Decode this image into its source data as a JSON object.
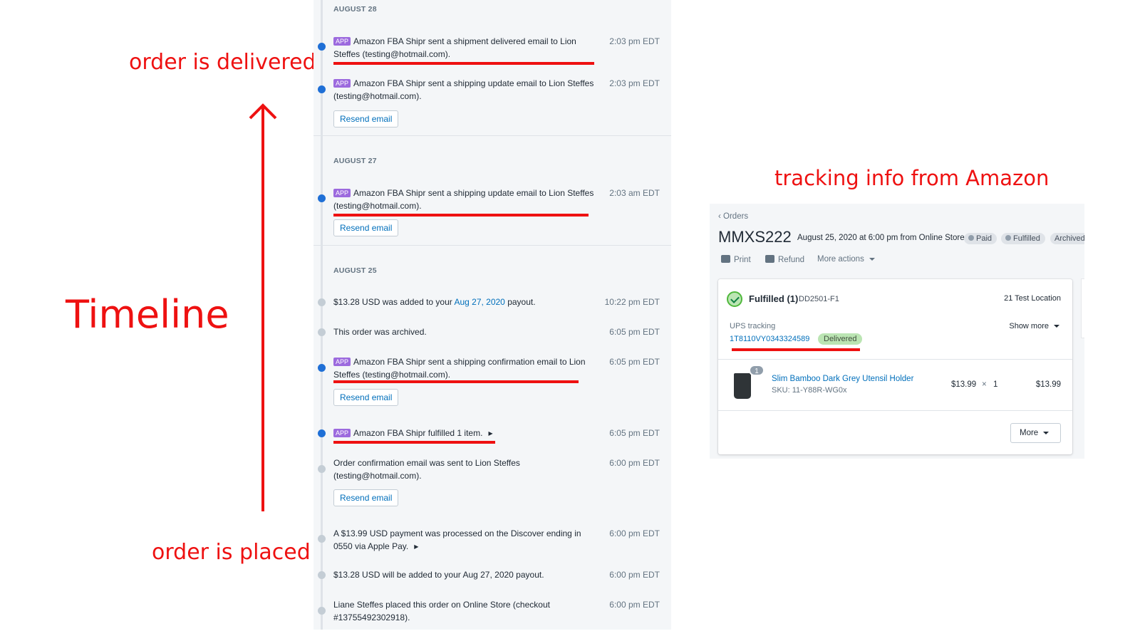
{
  "annotations": {
    "delivered": "order is delivered",
    "placed": "order is placed",
    "timeline": "Timeline",
    "tracking": "tracking info from Amazon"
  },
  "colors": {
    "annotation_red": "#ee1111",
    "app_badge": "#9c6ade",
    "link_blue": "#006fbb",
    "dot_blue": "#1f6fd6",
    "delivered_green": "#bbe5b3"
  },
  "timeline": {
    "app_badge": "APP",
    "resend_label": "Resend email",
    "days": [
      {
        "heading": "AUGUST 28",
        "events": [
          {
            "text": "Amazon FBA Shipr sent a shipment delivered email to Lion Steffes (testing@hotmail.com).",
            "time": "2:03 pm EDT"
          },
          {
            "text": "Amazon FBA Shipr sent a shipping update email to Lion Steffes (testing@hotmail.com).",
            "time": "2:03 pm EDT"
          }
        ]
      },
      {
        "heading": "AUGUST 27",
        "events": [
          {
            "text": "Amazon FBA Shipr sent a shipping update email to Lion Steffes (testing@hotmail.com).",
            "time": "2:03 am EDT"
          }
        ]
      },
      {
        "heading": "AUGUST 25",
        "events": [
          {
            "text_before": "$13.28 USD was added to your ",
            "link": "Aug 27, 2020",
            "text_after": " payout.",
            "time": "10:22 pm EDT"
          },
          {
            "text": "This order was archived.",
            "time": "6:05 pm EDT"
          },
          {
            "text": "Amazon FBA Shipr sent a shipping confirmation email to Lion Steffes (testing@hotmail.com).",
            "time": "6:05 pm EDT"
          },
          {
            "text": "Amazon FBA Shipr fulfilled 1 item.",
            "time": "6:05 pm EDT"
          },
          {
            "text": "Order confirmation email was sent to Lion Steffes (testing@hotmail.com).",
            "time": "6:00 pm EDT"
          },
          {
            "text": "A $13.99 USD payment was processed on the Discover ending in 0550 via Apple Pay.",
            "time": "6:00 pm EDT"
          },
          {
            "text": "$13.28 USD will be added to your Aug 27, 2020 payout.",
            "time": "6:00 pm EDT"
          },
          {
            "text": "Liane Steffes placed this order on Online Store (checkout #13755492302918).",
            "time": "6:00 pm EDT"
          }
        ]
      }
    ]
  },
  "order": {
    "back_link": "Orders",
    "title": "MMXS222",
    "subtitle": "August 25, 2020 at 6:00 pm from Online Store",
    "badges": [
      "Paid",
      "Fulfilled",
      "Archived"
    ],
    "actions": {
      "print": "Print",
      "refund": "Refund",
      "more_actions": "More actions"
    },
    "fulfillment": {
      "label": "Fulfilled (1)",
      "id": "DD2501-F1",
      "location": "21 Test Location",
      "tracking_label": "UPS tracking",
      "tracking_number": "1T8110VY0343324589",
      "tracking_status": "Delivered",
      "show_more": "Show more"
    },
    "line_item": {
      "name": "Slim Bamboo Dark Grey Utensil Holder",
      "sku": "SKU: 11-Y88R-WG0x",
      "unit_price": "$13.99",
      "times": "×",
      "quantity": "1",
      "total": "$13.99",
      "badge_qty": "1"
    },
    "more_button": "More"
  }
}
